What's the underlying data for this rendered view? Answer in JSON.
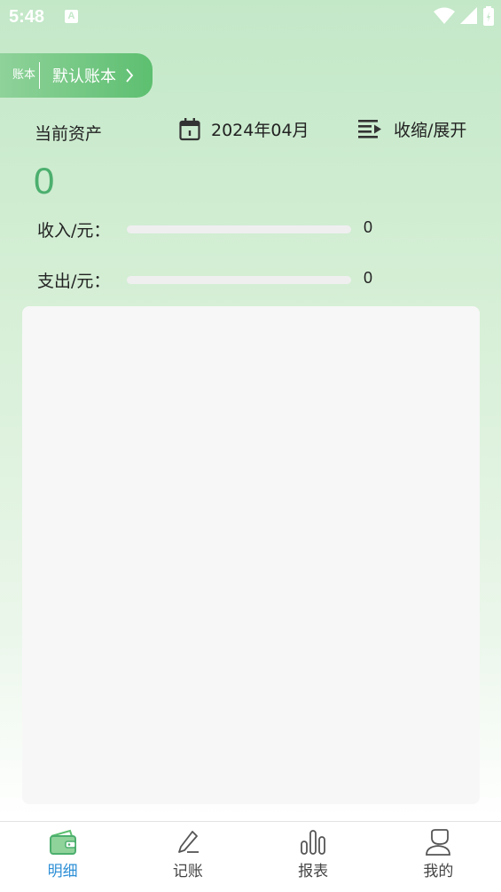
{
  "status": {
    "time": "5:48",
    "notif_icon": "A"
  },
  "account": {
    "tag": "账本",
    "name": "默认账本"
  },
  "summary": {
    "asset_label": "当前资产",
    "date": "2024年04月",
    "toggle_label": "收缩/展开",
    "asset_value": "0"
  },
  "income": {
    "label": "收入/元：",
    "value": "0",
    "progress": 0
  },
  "expense": {
    "label": "支出/元：",
    "value": "0",
    "progress": 0
  },
  "nav": [
    {
      "label": "明细",
      "icon": "wallet-icon",
      "active": true
    },
    {
      "label": "记账",
      "icon": "pen-icon",
      "active": false
    },
    {
      "label": "报表",
      "icon": "bar-chart-icon",
      "active": false
    },
    {
      "label": "我的",
      "icon": "user-icon",
      "active": false
    }
  ],
  "colors": {
    "accent": "#4caf6e",
    "active_tab": "#2d8fd6"
  }
}
